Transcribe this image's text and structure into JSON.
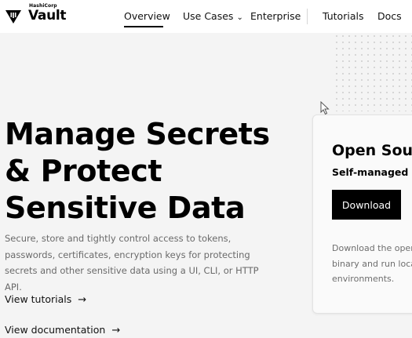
{
  "brand": {
    "company": "HashiCorp",
    "product": "Vault",
    "logo_icon": "hashicorp-triangle-logo"
  },
  "nav": {
    "items": [
      {
        "label": "Overview",
        "active": true
      },
      {
        "label": "Use Cases",
        "has_dropdown": true,
        "dropdown_icon": "chevron-down-icon"
      },
      {
        "label": "Enterprise"
      },
      {
        "label": "Tutorials"
      },
      {
        "label": "Docs"
      }
    ]
  },
  "hero": {
    "headline_line1": "Manage Secrets",
    "headline_line2": "& Protect",
    "headline_line3": "Sensitive Data",
    "subtext": "Secure, store and tightly control access to tokens, passwords, certificates, encryption keys for protecting secrets and other sensitive data using a UI, CLI, or HTTP API.",
    "links": [
      {
        "label": "View tutorials",
        "icon": "arrow-right-icon"
      },
      {
        "label": "View documentation",
        "icon": "arrow-right-icon"
      }
    ]
  },
  "card": {
    "title": "Open Sourc",
    "subtitle": "Self-managed | c",
    "button_label": "Download",
    "description": "Download the open binary and run loca environments."
  },
  "colors": {
    "page_bg": "#f4f4f4",
    "nav_bg": "#ffffff",
    "button_bg": "#000000",
    "muted_text": "#6a6a6a"
  }
}
